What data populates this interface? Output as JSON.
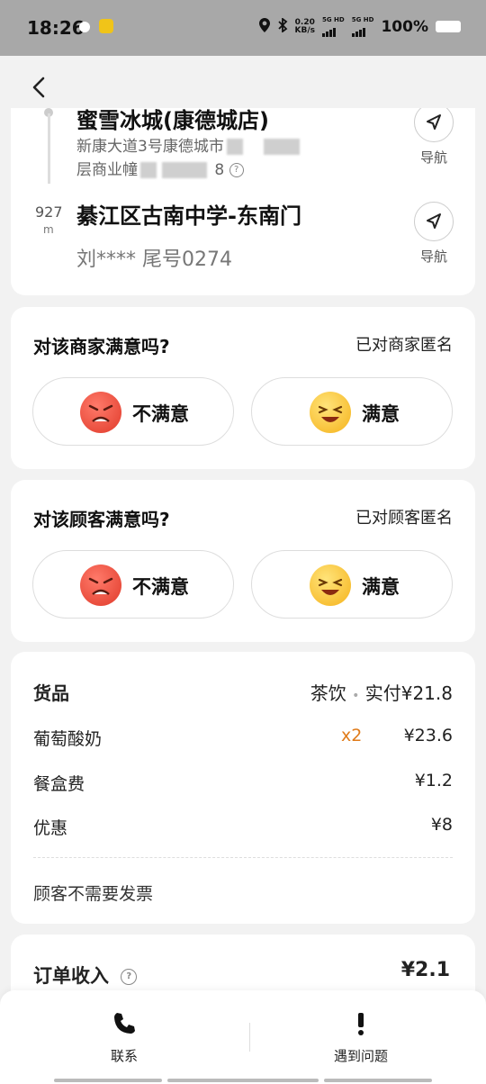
{
  "status_bar": {
    "time": "18:26",
    "net_speed_value": "0.20",
    "net_speed_unit": "KB/s",
    "sim1": "5G HD",
    "sim2": "5G HD",
    "battery": "100%"
  },
  "route": {
    "shop_name": "蜜雪冰城(康德城店)",
    "shop_address_part1": "新康大道3号康德城市",
    "shop_address_part2": "层商业幢",
    "shop_address_part3": "8",
    "distance": "927",
    "distance_unit": "m",
    "customer_address": "綦江区古南中学-东南门",
    "customer_name": "刘**** 尾号0274",
    "nav_label": "导航"
  },
  "merchant_rating": {
    "title": "对该商家满意吗?",
    "anon": "已对商家匿名",
    "dissatisfied": "不满意",
    "satisfied": "满意"
  },
  "customer_rating": {
    "title": "对该顾客满意吗?",
    "anon": "已对顾客匿名",
    "dissatisfied": "不满意",
    "satisfied": "满意"
  },
  "goods": {
    "title": "货品",
    "category": "茶饮",
    "separator": "•",
    "paid": "实付¥21.8",
    "items": [
      {
        "name": "葡萄酸奶",
        "qty": "x2",
        "price": "¥23.6"
      },
      {
        "name": "餐盒费",
        "qty": "",
        "price": "¥1.2"
      },
      {
        "name": "优惠",
        "qty": "",
        "price": "¥8"
      }
    ],
    "invoice_note": "顾客不需要发票"
  },
  "income": {
    "label": "订单收入",
    "value": "¥2.1"
  },
  "bottom": {
    "contact": "联系",
    "problem": "遇到问题"
  }
}
